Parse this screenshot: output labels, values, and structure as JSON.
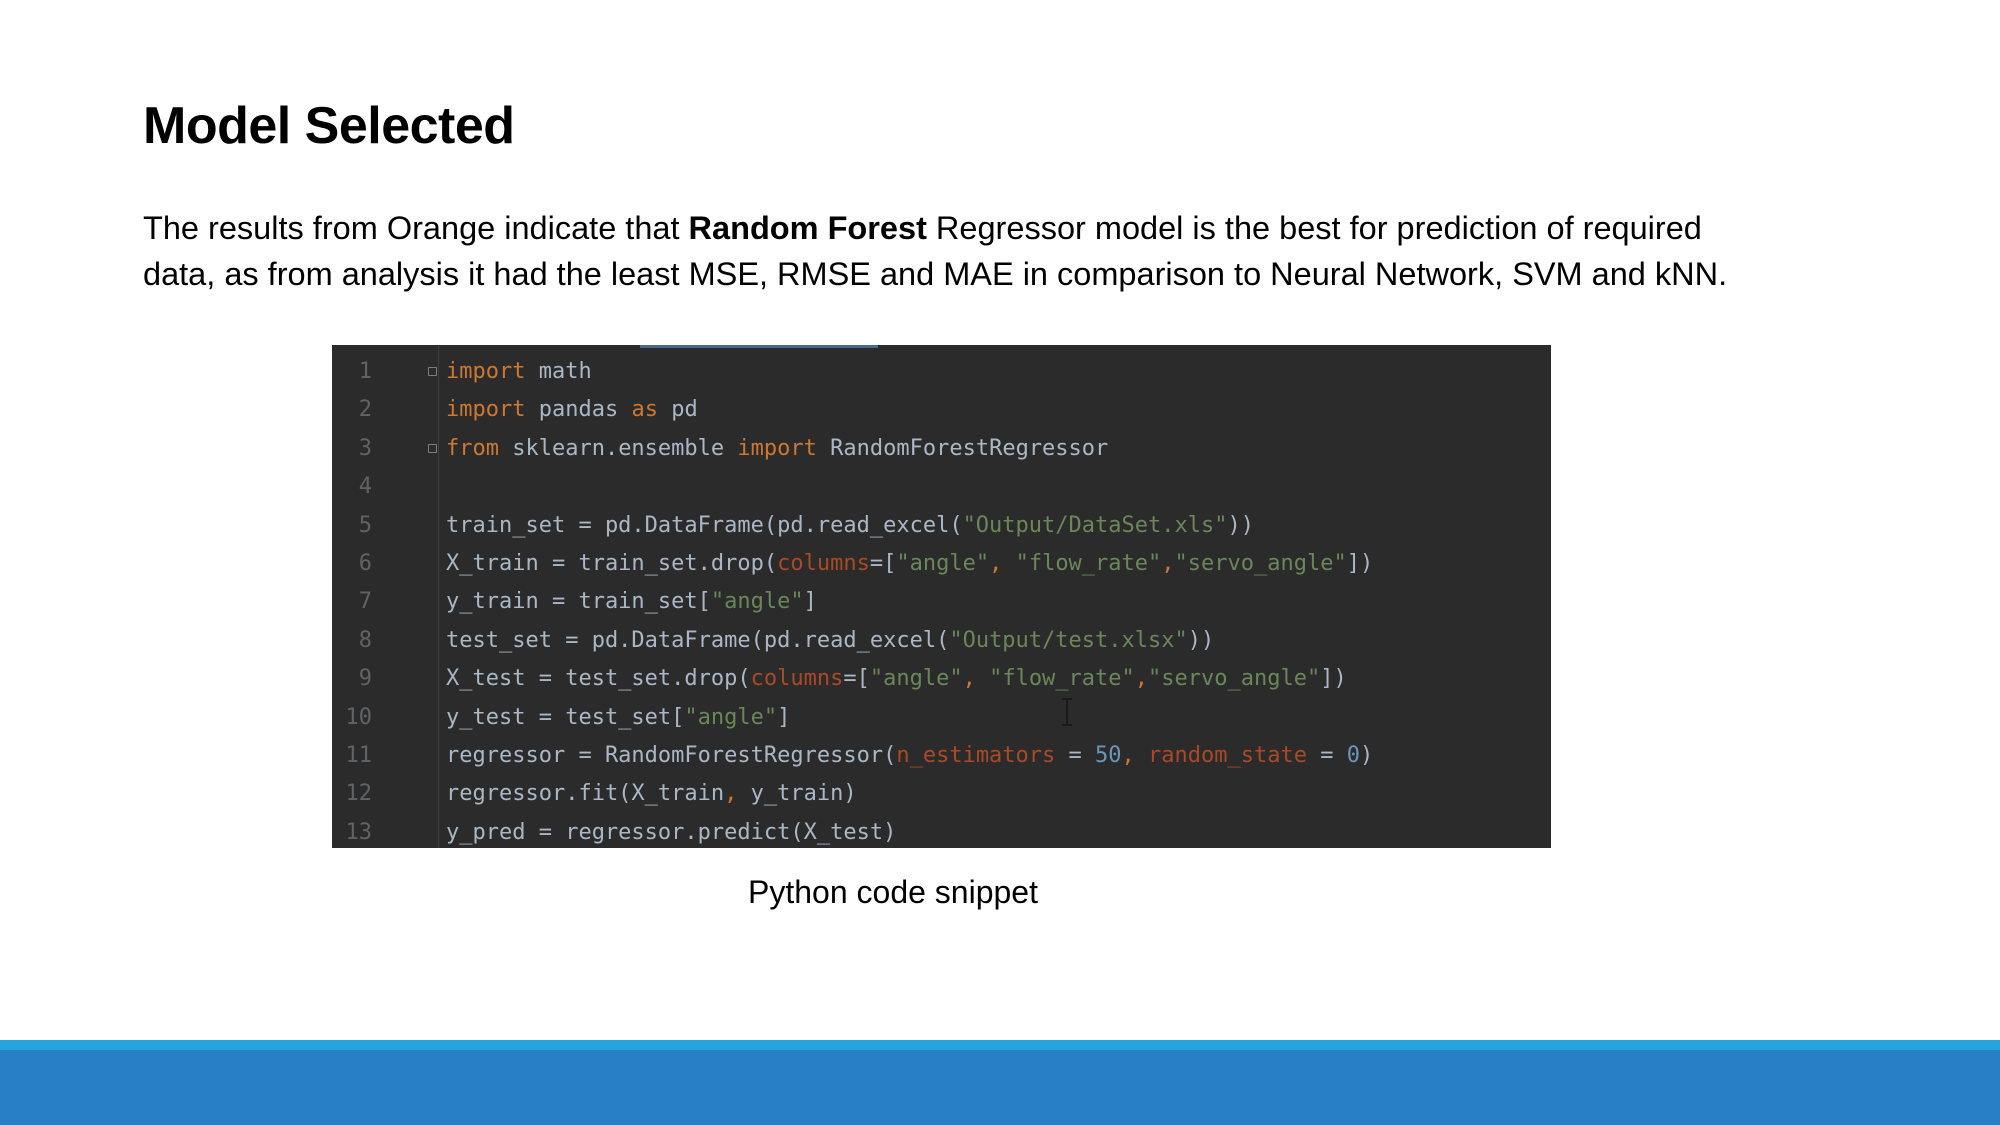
{
  "slide": {
    "title": "Model Selected",
    "body_part1": "The results from Orange indicate that ",
    "body_bold": "Random Forest",
    "body_part2": " Regressor model is the best for prediction of required",
    "body_line2": "data, as from analysis  it had the least MSE, RMSE and MAE in comparison to Neural Network, SVM and kNN.",
    "caption": "Python code snippet"
  },
  "code": {
    "lines": [
      {
        "n": "1",
        "tokens": [
          {
            "t": "kw",
            "v": "import"
          },
          {
            "t": "",
            "v": " math"
          }
        ]
      },
      {
        "n": "2",
        "tokens": [
          {
            "t": "kw",
            "v": "import"
          },
          {
            "t": "",
            "v": " pandas "
          },
          {
            "t": "kw",
            "v": "as"
          },
          {
            "t": "",
            "v": " pd"
          }
        ]
      },
      {
        "n": "3",
        "tokens": [
          {
            "t": "kw",
            "v": "from"
          },
          {
            "t": "",
            "v": " sklearn.ensemble "
          },
          {
            "t": "kw",
            "v": "import"
          },
          {
            "t": "",
            "v": " RandomForestRegressor"
          }
        ]
      },
      {
        "n": "4",
        "tokens": []
      },
      {
        "n": "5",
        "tokens": [
          {
            "t": "",
            "v": "train_set = pd.DataFrame(pd.read_excel("
          },
          {
            "t": "st",
            "v": "\"Output/DataSet.xls\""
          },
          {
            "t": "",
            "v": "))"
          }
        ]
      },
      {
        "n": "6",
        "tokens": [
          {
            "t": "",
            "v": "X_train = train_set.drop("
          },
          {
            "t": "pr",
            "v": "columns"
          },
          {
            "t": "",
            "v": "=["
          },
          {
            "t": "st",
            "v": "\"angle\""
          },
          {
            "t": "kw",
            "v": ", "
          },
          {
            "t": "st",
            "v": "\"flow_rate\""
          },
          {
            "t": "kw",
            "v": ","
          },
          {
            "t": "st",
            "v": "\"servo_angle\""
          },
          {
            "t": "",
            "v": "])"
          }
        ]
      },
      {
        "n": "7",
        "tokens": [
          {
            "t": "",
            "v": "y_train = train_set["
          },
          {
            "t": "st",
            "v": "\"angle\""
          },
          {
            "t": "",
            "v": "]"
          }
        ]
      },
      {
        "n": "8",
        "tokens": [
          {
            "t": "",
            "v": "test_set = pd.DataFrame(pd.read_excel("
          },
          {
            "t": "st",
            "v": "\"Output/test.xlsx\""
          },
          {
            "t": "",
            "v": "))"
          }
        ]
      },
      {
        "n": "9",
        "tokens": [
          {
            "t": "",
            "v": "X_test = test_set.drop("
          },
          {
            "t": "pr",
            "v": "columns"
          },
          {
            "t": "",
            "v": "=["
          },
          {
            "t": "st",
            "v": "\"angle\""
          },
          {
            "t": "kw",
            "v": ", "
          },
          {
            "t": "st",
            "v": "\"flow_rate\""
          },
          {
            "t": "kw",
            "v": ","
          },
          {
            "t": "st",
            "v": "\"servo_angle\""
          },
          {
            "t": "",
            "v": "])"
          }
        ]
      },
      {
        "n": "10",
        "tokens": [
          {
            "t": "",
            "v": "y_test = test_set["
          },
          {
            "t": "st",
            "v": "\"angle\""
          },
          {
            "t": "",
            "v": "]"
          }
        ]
      },
      {
        "n": "11",
        "tokens": [
          {
            "t": "",
            "v": "regressor = RandomForestRegressor("
          },
          {
            "t": "pr",
            "v": "n_estimators"
          },
          {
            "t": "",
            "v": " = "
          },
          {
            "t": "nu",
            "v": "50"
          },
          {
            "t": "kw",
            "v": ", "
          },
          {
            "t": "pr",
            "v": "random_state"
          },
          {
            "t": "",
            "v": " = "
          },
          {
            "t": "nu",
            "v": "0"
          },
          {
            "t": "",
            "v": ")"
          }
        ]
      },
      {
        "n": "12",
        "tokens": [
          {
            "t": "",
            "v": "regressor.fit(X_train"
          },
          {
            "t": "kw",
            "v": ", "
          },
          {
            "t": "",
            "v": "y_train)"
          }
        ]
      },
      {
        "n": "13",
        "tokens": [
          {
            "t": "",
            "v": "y_pred = regressor.predict(X_test)"
          }
        ]
      }
    ],
    "folds": [
      "1",
      "3"
    ],
    "colors": {
      "background": "#2b2b2b",
      "default": "#a9b7c6",
      "keyword": "#cc7832",
      "string": "#6a8759",
      "param": "#aa4926",
      "number": "#6897bb",
      "line_number": "#606366"
    }
  },
  "footer": {
    "stripe_color": "#27a3dc",
    "bar_color": "#2680c3"
  }
}
